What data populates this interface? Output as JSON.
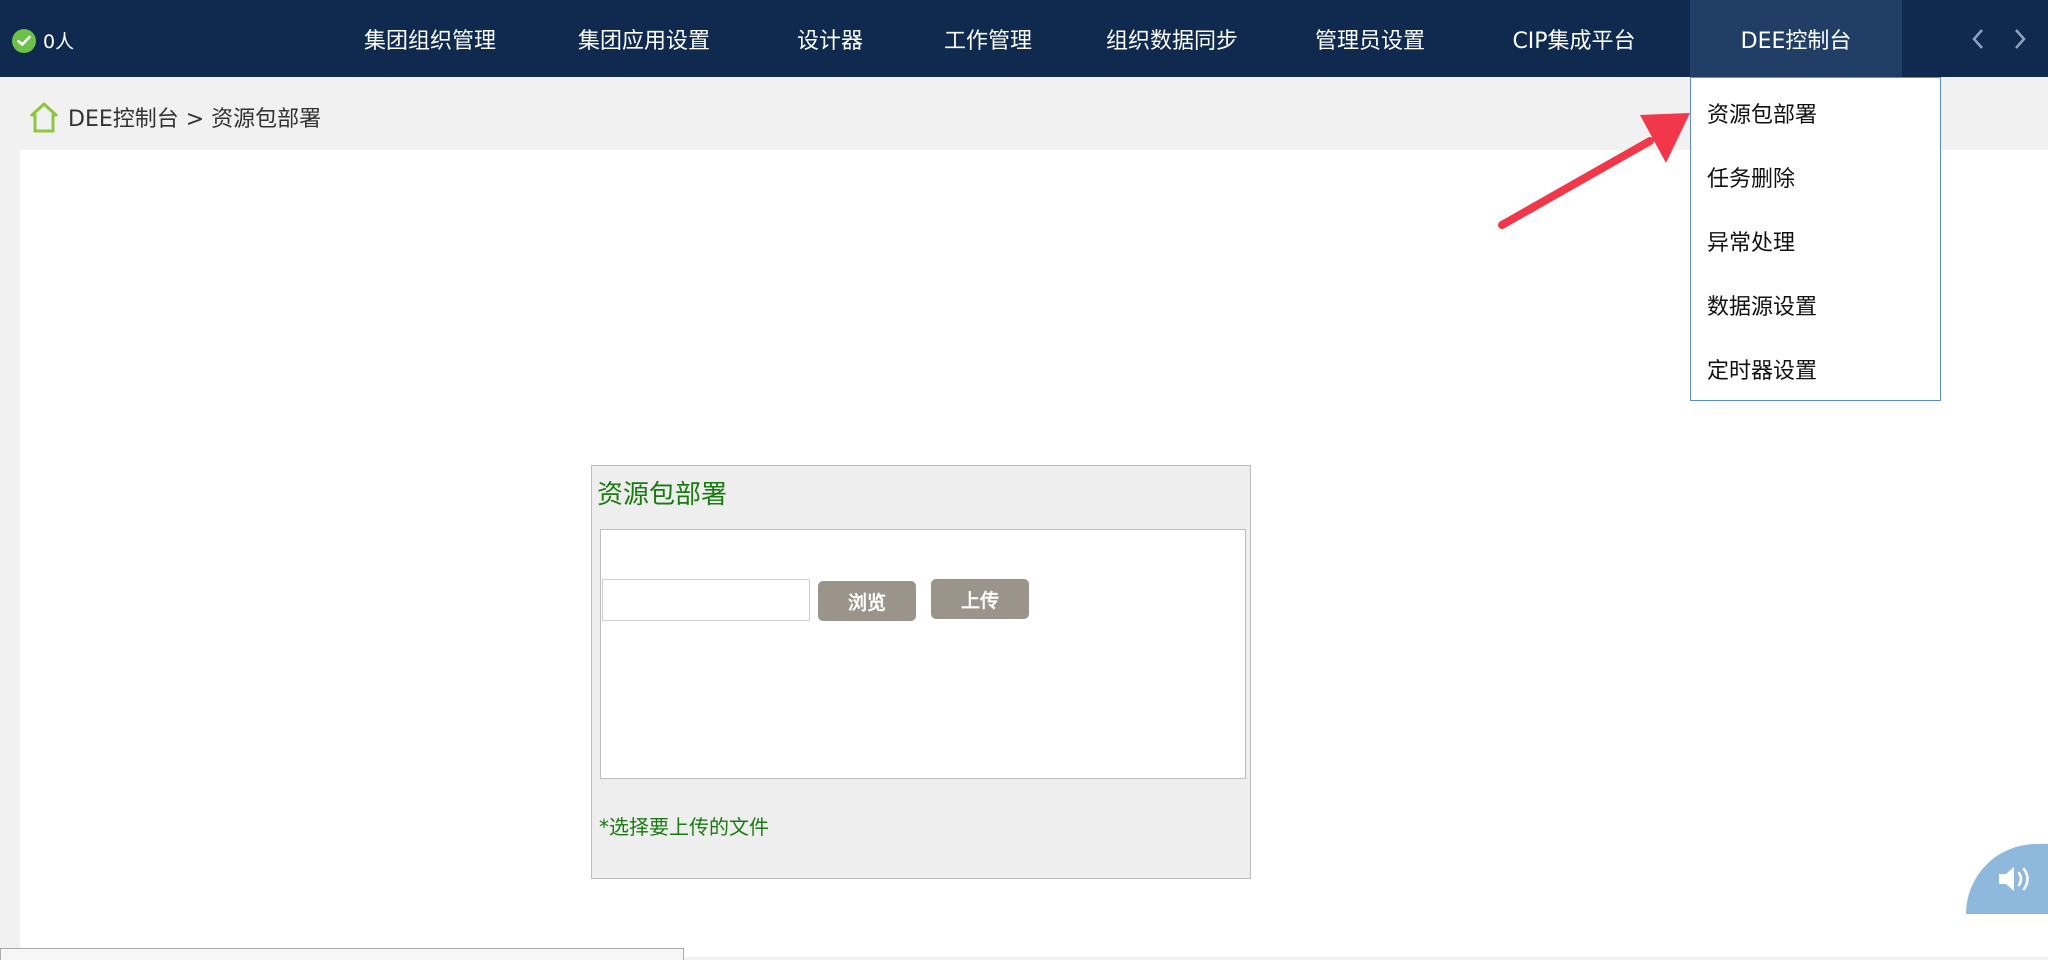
{
  "header": {
    "online_count": "0人",
    "nav": [
      {
        "label": "集团组织管理"
      },
      {
        "label": "集团应用设置"
      },
      {
        "label": "设计器"
      },
      {
        "label": "工作管理"
      },
      {
        "label": "组织数据同步"
      },
      {
        "label": "管理员设置"
      },
      {
        "label": "CIP集成平台"
      },
      {
        "label": "DEE控制台"
      }
    ],
    "active_nav": "DEE控制台"
  },
  "breadcrumb": {
    "text": "DEE控制台 > 资源包部署"
  },
  "panel": {
    "title": "资源包部署",
    "browse_label": "浏览",
    "upload_label": "上传",
    "hint": "*选择要上传的文件"
  },
  "dropdown": {
    "items": [
      {
        "label": "资源包部署"
      },
      {
        "label": "任务删除"
      },
      {
        "label": "异常处理"
      },
      {
        "label": "数据源设置"
      },
      {
        "label": "定时器设置"
      }
    ]
  },
  "colors": {
    "topbar": "#0f2a4e",
    "active_tab": "#213e66",
    "green_text": "#1a7a12",
    "button": "#9b948b",
    "arrow": "#f0384a",
    "dropdown_border": "#5b8bd0"
  },
  "icons": {
    "online": "check-circle-icon",
    "home": "home-icon",
    "prev": "chevron-left-icon",
    "next": "chevron-right-icon",
    "speaker": "speaker-icon",
    "annotation": "red-arrow-icon"
  }
}
